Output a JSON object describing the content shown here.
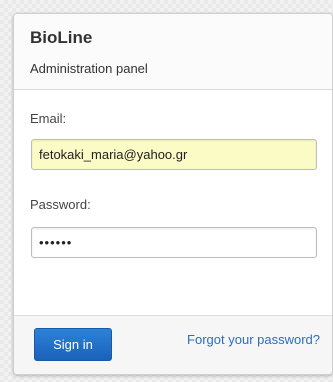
{
  "header": {
    "title": "BioLine",
    "subtitle": "Administration panel"
  },
  "form": {
    "email_label": "Email:",
    "email_value": "fetokaki_maria@yahoo.gr",
    "password_label": "Password:",
    "password_value": "••••••"
  },
  "footer": {
    "signin_label": "Sign in",
    "forgot_label": "Forgot your password?"
  },
  "colors": {
    "accent": "#1a62b8",
    "link": "#2a6fbf",
    "autofill_background": "#fbfbc6"
  }
}
